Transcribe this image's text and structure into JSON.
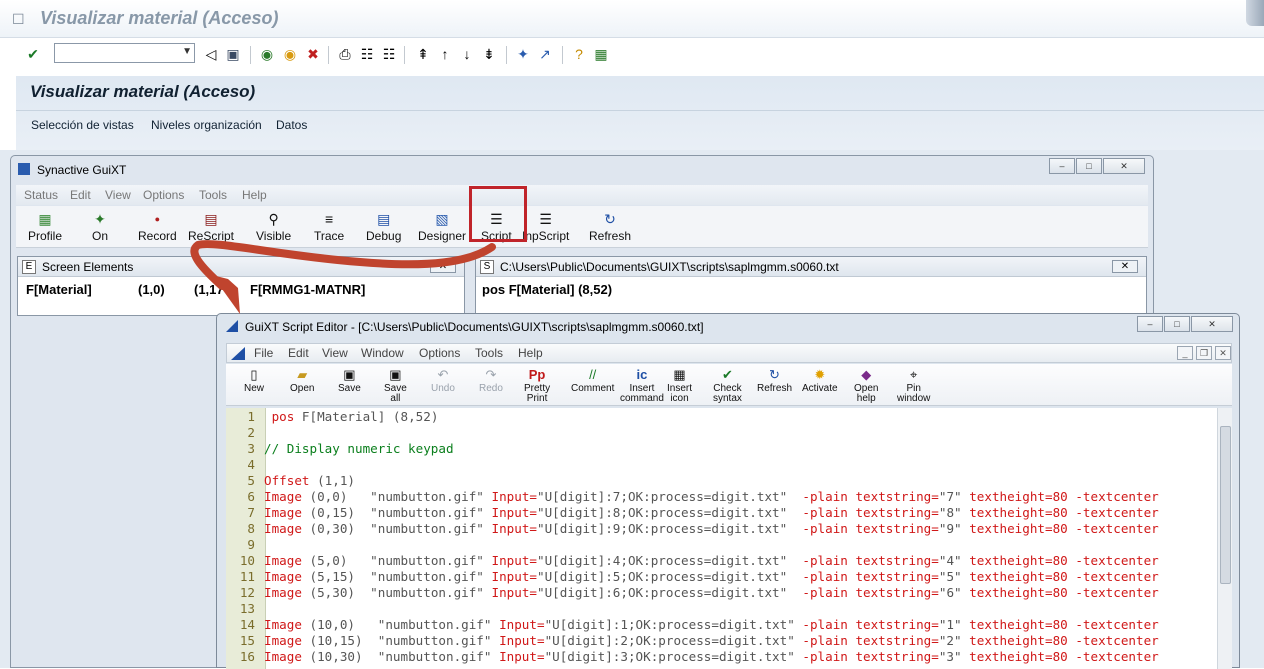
{
  "sap": {
    "window_title": "Visualizar material (Acceso)",
    "screen_title": "Visualizar material (Acceso)",
    "header_buttons": [
      "Selección de vistas",
      "Niveles organización",
      "Datos"
    ]
  },
  "guixt": {
    "title": "Synactive GuiXT",
    "menu": [
      "Status",
      "Edit",
      "View",
      "Options",
      "Tools",
      "Help"
    ],
    "toolbar": [
      "Profile",
      "On",
      "Record",
      "ReScript",
      "Visible",
      "Trace",
      "Debug",
      "Designer",
      "Script",
      "InpScript",
      "Refresh"
    ],
    "screen_elements": {
      "title": "Screen Elements",
      "row": [
        "F[Material]",
        "(1,0)",
        "(1,17",
        "F[RMMG1-MATNR]"
      ]
    },
    "script_panel": {
      "title": "C:\\Users\\Public\\Documents\\GUIXT\\scripts\\saplmgmm.s0060.txt",
      "content": "pos F[Material] (8,52)"
    }
  },
  "editor": {
    "title": "GuiXT Script Editor - [C:\\Users\\Public\\Documents\\GUIXT\\scripts\\saplmgmm.s0060.txt]",
    "menu": [
      "File",
      "Edit",
      "View",
      "Window",
      "Options",
      "Tools",
      "Help"
    ],
    "toolbar": [
      {
        "l1": "New",
        "l2": ""
      },
      {
        "l1": "Open",
        "l2": ""
      },
      {
        "l1": "Save",
        "l2": ""
      },
      {
        "l1": "Save",
        "l2": "all"
      },
      {
        "l1": "Undo",
        "l2": ""
      },
      {
        "l1": "Redo",
        "l2": ""
      },
      {
        "l1": "Pretty",
        "l2": "Print"
      },
      {
        "l1": "Comment",
        "l2": ""
      },
      {
        "l1": "Insert",
        "l2": "command"
      },
      {
        "l1": "Insert",
        "l2": "icon"
      },
      {
        "l1": "Check",
        "l2": "syntax"
      },
      {
        "l1": "Refresh",
        "l2": ""
      },
      {
        "l1": "Activate",
        "l2": ""
      },
      {
        "l1": "Open",
        "l2": "help"
      },
      {
        "l1": "Pin",
        "l2": "window"
      }
    ],
    "code": [
      {
        "n": "1",
        "a": " pos",
        "b": " F[Material] (8,52)",
        "c": ""
      },
      {
        "n": "2",
        "a": "",
        "b": "",
        "c": ""
      },
      {
        "n": "3",
        "a": "",
        "b": "",
        "c": "// Display numeric keypad"
      },
      {
        "n": "4",
        "a": "",
        "b": "",
        "c": ""
      },
      {
        "n": "5",
        "a": "Offset",
        "b": " (1,1)",
        "c": ""
      },
      {
        "n": "6",
        "a": "Image",
        "b": " (0,0)   \"numbutton.gif\" ",
        "c": "",
        "k": "Input=",
        "v": "\"U[digit]:7;OK:process=digit.txt\"",
        "r": "  -plain textstring=",
        "s": "\"7\"",
        "t": " textheight=80 -textcenter"
      },
      {
        "n": "7",
        "a": "Image",
        "b": " (0,15)  \"numbutton.gif\" ",
        "c": "",
        "k": "Input=",
        "v": "\"U[digit]:8;OK:process=digit.txt\"",
        "r": "  -plain textstring=",
        "s": "\"8\"",
        "t": " textheight=80 -textcenter"
      },
      {
        "n": "8",
        "a": "Image",
        "b": " (0,30)  \"numbutton.gif\" ",
        "c": "",
        "k": "Input=",
        "v": "\"U[digit]:9;OK:process=digit.txt\"",
        "r": "  -plain textstring=",
        "s": "\"9\"",
        "t": " textheight=80 -textcenter"
      },
      {
        "n": "9",
        "a": "",
        "b": "",
        "c": ""
      },
      {
        "n": "10",
        "a": "Image",
        "b": " (5,0)   \"numbutton.gif\" ",
        "c": "",
        "k": "Input=",
        "v": "\"U[digit]:4;OK:process=digit.txt\"",
        "r": "  -plain textstring=",
        "s": "\"4\"",
        "t": " textheight=80 -textcenter"
      },
      {
        "n": "11",
        "a": "Image",
        "b": " (5,15)  \"numbutton.gif\" ",
        "c": "",
        "k": "Input=",
        "v": "\"U[digit]:5;OK:process=digit.txt\"",
        "r": "  -plain textstring=",
        "s": "\"5\"",
        "t": " textheight=80 -textcenter"
      },
      {
        "n": "12",
        "a": "Image",
        "b": " (5,30)  \"numbutton.gif\" ",
        "c": "",
        "k": "Input=",
        "v": "\"U[digit]:6;OK:process=digit.txt\"",
        "r": "  -plain textstring=",
        "s": "\"6\"",
        "t": " textheight=80 -textcenter"
      },
      {
        "n": "13",
        "a": "",
        "b": "",
        "c": ""
      },
      {
        "n": "14",
        "a": "Image",
        "b": " (10,0)   \"numbutton.gif\" ",
        "c": "",
        "k": "Input=",
        "v": "\"U[digit]:1;OK:process=digit.txt\"",
        "r": " -plain textstring=",
        "s": "\"1\"",
        "t": " textheight=80 -textcenter"
      },
      {
        "n": "15",
        "a": "Image",
        "b": " (10,15)  \"numbutton.gif\" ",
        "c": "",
        "k": "Input=",
        "v": "\"U[digit]:2;OK:process=digit.txt\"",
        "r": " -plain textstring=",
        "s": "\"2\"",
        "t": " textheight=80 -textcenter"
      },
      {
        "n": "16",
        "a": "Image",
        "b": " (10,30)  \"numbutton.gif\" ",
        "c": "",
        "k": "Input=",
        "v": "\"U[digit]:3;OK:process=digit.txt\"",
        "r": " -plain textstring=",
        "s": "\"3\"",
        "t": " textheight=80 -textcenter"
      }
    ]
  },
  "colors": {
    "highlight": "#c0242a",
    "arrow": "#c0442e"
  }
}
